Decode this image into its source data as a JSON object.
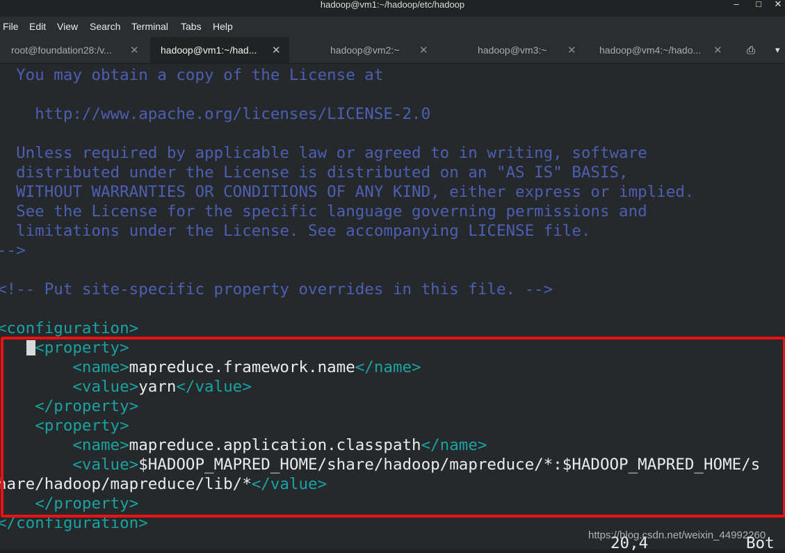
{
  "window": {
    "title": "hadoop@vm1:~/hadoop/etc/hadoop",
    "minimize_glyph": "–",
    "maximize_glyph": "□",
    "close_glyph": "✕"
  },
  "menu": [
    "File",
    "Edit",
    "View",
    "Search",
    "Terminal",
    "Tabs",
    "Help"
  ],
  "tabs": [
    {
      "label": "root@foundation28:/v...",
      "active": false
    },
    {
      "label": "hadoop@vm1:~/had...",
      "active": true
    },
    {
      "label": "hadoop@vm2:~",
      "active": false
    },
    {
      "label": "hadoop@vm3:~",
      "active": false
    },
    {
      "label": "hadoop@vm4:~/hado...",
      "active": false
    }
  ],
  "tab_close_glyph": "✕",
  "tabbar_icons": {
    "new_tab": "⎙",
    "dropdown": "▾"
  },
  "terminal": {
    "lines": [
      [
        {
          "t": "  You may obtain a copy of the License at",
          "c": "comment"
        }
      ],
      [
        {
          "t": "",
          "c": "comment"
        }
      ],
      [
        {
          "t": "    http://www.apache.org/licenses/LICENSE-2.0",
          "c": "comment"
        }
      ],
      [
        {
          "t": "",
          "c": "comment"
        }
      ],
      [
        {
          "t": "  Unless required by applicable law or agreed to in writing, software",
          "c": "comment"
        }
      ],
      [
        {
          "t": "  distributed under the License is distributed on an \"AS IS\" BASIS,",
          "c": "comment"
        }
      ],
      [
        {
          "t": "  WITHOUT WARRANTIES OR CONDITIONS OF ANY KIND, either express or implied.",
          "c": "comment"
        }
      ],
      [
        {
          "t": "  See the License for the specific language governing permissions and",
          "c": "comment"
        }
      ],
      [
        {
          "t": "  limitations under the License. See accompanying LICENSE file.",
          "c": "comment"
        }
      ],
      [
        {
          "t": "-->",
          "c": "comment"
        }
      ],
      [
        {
          "t": "",
          "c": "comment"
        }
      ],
      [
        {
          "t": "<!-- Put site-specific property overrides in this file. -->",
          "c": "comment"
        }
      ],
      [
        {
          "t": "",
          "c": "comment"
        }
      ],
      [
        {
          "t": "<configuration>",
          "c": "tag"
        }
      ],
      [
        {
          "t": "    ",
          "c": "text"
        },
        {
          "t": "<property>",
          "c": "tag"
        }
      ],
      [
        {
          "t": "        ",
          "c": "text"
        },
        {
          "t": "<name>",
          "c": "tag"
        },
        {
          "t": "mapreduce.framework.name",
          "c": "text"
        },
        {
          "t": "</name>",
          "c": "tag"
        }
      ],
      [
        {
          "t": "        ",
          "c": "text"
        },
        {
          "t": "<value>",
          "c": "tag"
        },
        {
          "t": "yarn",
          "c": "text"
        },
        {
          "t": "</value>",
          "c": "tag"
        }
      ],
      [
        {
          "t": "    ",
          "c": "text"
        },
        {
          "t": "</property>",
          "c": "tag"
        }
      ],
      [
        {
          "t": "    ",
          "c": "text"
        },
        {
          "t": "<property>",
          "c": "tag"
        }
      ],
      [
        {
          "t": "        ",
          "c": "text"
        },
        {
          "t": "<name>",
          "c": "tag"
        },
        {
          "t": "mapreduce.application.classpath",
          "c": "text"
        },
        {
          "t": "</name>",
          "c": "tag"
        }
      ],
      [
        {
          "t": "        ",
          "c": "text"
        },
        {
          "t": "<value>",
          "c": "tag"
        },
        {
          "t": "$HADOOP_MAPRED_HOME/share/hadoop/mapreduce/*:$HADOOP_MAPRED_HOME/s",
          "c": "text"
        }
      ],
      [
        {
          "t": "hare/hadoop/mapreduce/lib/*",
          "c": "text"
        },
        {
          "t": "</value>",
          "c": "tag"
        }
      ],
      [
        {
          "t": "    ",
          "c": "text"
        },
        {
          "t": "</property>",
          "c": "tag"
        }
      ],
      [
        {
          "t": "</configuration>",
          "c": "tag"
        }
      ]
    ],
    "cursor_line": 14,
    "status_position": "20,4",
    "status_scroll": "Bot"
  },
  "watermark": "https://blog.csdn.net/weixin_44992260",
  "colors": {
    "comment": "#4d5fb3",
    "tag": "#19a3a3",
    "text": "#ebebeb",
    "highlight": "#ee1111",
    "background": "#26292b"
  }
}
